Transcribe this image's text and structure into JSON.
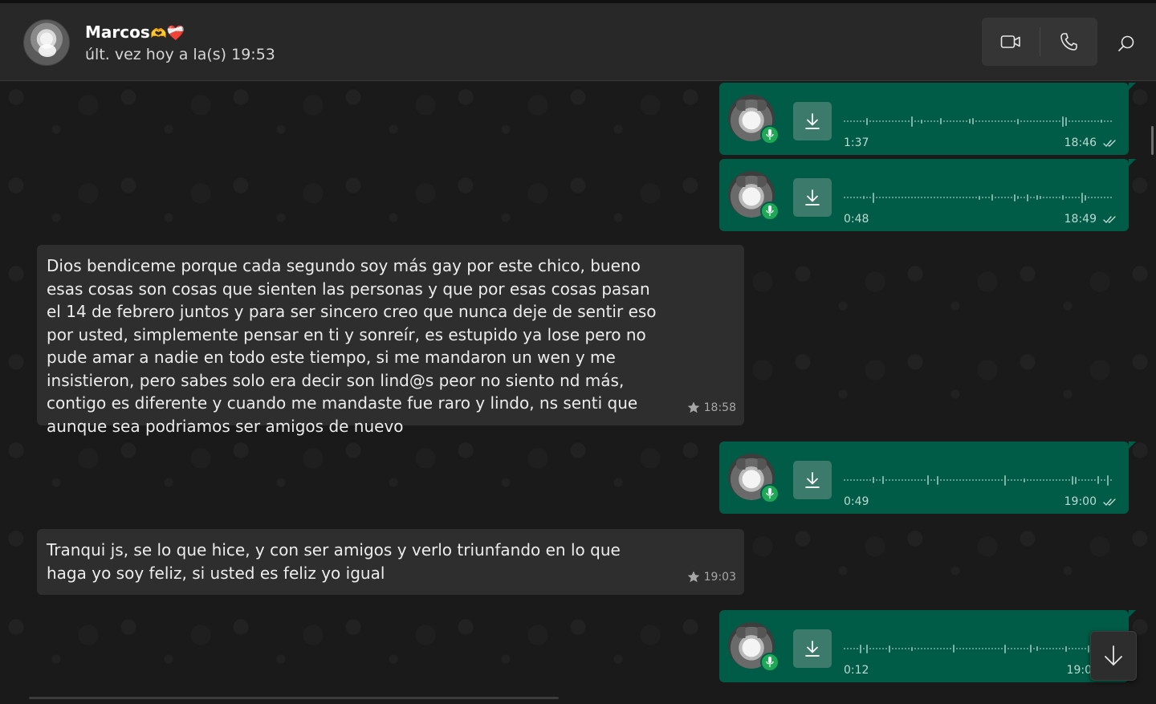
{
  "header": {
    "contact_name": "Marcos",
    "name_emojis": [
      "🫶",
      "❤️‍🩹"
    ],
    "last_seen": "últ. vez hoy a la(s) 19:53",
    "buttons": {
      "video_icon": "video-camera-icon",
      "call_icon": "phone-icon",
      "search_icon": "search-icon"
    }
  },
  "colors": {
    "outgoing_bubble": "#005b47",
    "incoming_bubble": "#2e2e2e",
    "mic_badge": "#1fa855"
  },
  "messages": [
    {
      "kind": "voice",
      "direction": "outgoing",
      "duration": "1:37",
      "time": "18:46",
      "status": "read"
    },
    {
      "kind": "voice",
      "direction": "outgoing",
      "duration": "0:48",
      "time": "18:49",
      "status": "read"
    },
    {
      "kind": "text",
      "direction": "incoming",
      "starred": true,
      "time": "18:58",
      "text": "Dios bendiceme porque cada segundo soy más gay por este chico, bueno esas cosas son cosas que sienten las personas y que por esas cosas pasan el 14 de febrero juntos y para ser sincero creo que nunca deje de sentir eso por usted, simplemente pensar en ti y sonreír, es estupido ya lose pero no pude amar a nadie en todo este tiempo, si me mandaron un wen y me insistieron, pero sabes solo era decir son lind@s peor no siento nd más, contigo es diferente y cuando me mandaste fue raro y lindo, ns senti que aunque sea podriamos ser amigos de nuevo"
    },
    {
      "kind": "voice",
      "direction": "outgoing",
      "duration": "0:49",
      "time": "19:00",
      "status": "read"
    },
    {
      "kind": "text",
      "direction": "incoming",
      "starred": true,
      "time": "19:03",
      "text": "Tranqui js, se lo que hice, y con ser amigos y verlo triunfando en lo que haga yo soy feliz, si usted es feliz yo igual"
    },
    {
      "kind": "voice",
      "direction": "outgoing",
      "duration": "0:12",
      "time": "19:0",
      "status": "read"
    }
  ]
}
